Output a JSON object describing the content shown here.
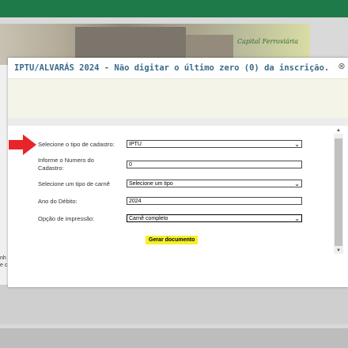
{
  "header": {
    "bar_color": "#1f7a4a"
  },
  "banner": {
    "logo_text": "Capital Ferroviária"
  },
  "dialog": {
    "title": "IPTU/ALVARÁS 2024 - Não digitar o último zero (0) da inscrição.",
    "close_icon": "close-circle-icon"
  },
  "form": {
    "cadastro_label": "Selecione o tipo de cadastro:",
    "cadastro_value": "IPTU",
    "numero_label_line1": "Informe o Numero do",
    "numero_label_line2": "Cadastro:",
    "numero_value": "0",
    "carne_label": "Selecione um tipo de carnê",
    "carne_value": "Selecione um tipo",
    "ano_label": "Ano do Débito:",
    "ano_value": "2024",
    "impressao_label": "Opção de impressão:",
    "impressao_value": "Carnê completo",
    "generate_button": "Gerar documento"
  },
  "side": {
    "line1": "nh",
    "line2": "e c"
  },
  "colors": {
    "accent": "#f5f02a",
    "title": "#3a6a8a",
    "pointer": "#e8242a"
  }
}
